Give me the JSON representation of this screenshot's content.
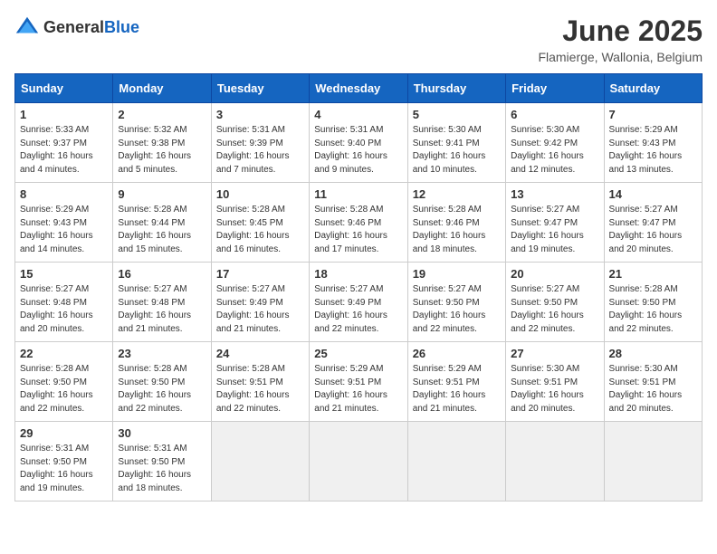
{
  "logo": {
    "general": "General",
    "blue": "Blue"
  },
  "title": "June 2025",
  "location": "Flamierge, Wallonia, Belgium",
  "days_of_week": [
    "Sunday",
    "Monday",
    "Tuesday",
    "Wednesday",
    "Thursday",
    "Friday",
    "Saturday"
  ],
  "weeks": [
    [
      {
        "day": "1",
        "sunrise": "5:33 AM",
        "sunset": "9:37 PM",
        "daylight": "16 hours and 4 minutes."
      },
      {
        "day": "2",
        "sunrise": "5:32 AM",
        "sunset": "9:38 PM",
        "daylight": "16 hours and 5 minutes."
      },
      {
        "day": "3",
        "sunrise": "5:31 AM",
        "sunset": "9:39 PM",
        "daylight": "16 hours and 7 minutes."
      },
      {
        "day": "4",
        "sunrise": "5:31 AM",
        "sunset": "9:40 PM",
        "daylight": "16 hours and 9 minutes."
      },
      {
        "day": "5",
        "sunrise": "5:30 AM",
        "sunset": "9:41 PM",
        "daylight": "16 hours and 10 minutes."
      },
      {
        "day": "6",
        "sunrise": "5:30 AM",
        "sunset": "9:42 PM",
        "daylight": "16 hours and 12 minutes."
      },
      {
        "day": "7",
        "sunrise": "5:29 AM",
        "sunset": "9:43 PM",
        "daylight": "16 hours and 13 minutes."
      }
    ],
    [
      {
        "day": "8",
        "sunrise": "5:29 AM",
        "sunset": "9:43 PM",
        "daylight": "16 hours and 14 minutes."
      },
      {
        "day": "9",
        "sunrise": "5:28 AM",
        "sunset": "9:44 PM",
        "daylight": "16 hours and 15 minutes."
      },
      {
        "day": "10",
        "sunrise": "5:28 AM",
        "sunset": "9:45 PM",
        "daylight": "16 hours and 16 minutes."
      },
      {
        "day": "11",
        "sunrise": "5:28 AM",
        "sunset": "9:46 PM",
        "daylight": "16 hours and 17 minutes."
      },
      {
        "day": "12",
        "sunrise": "5:28 AM",
        "sunset": "9:46 PM",
        "daylight": "16 hours and 18 minutes."
      },
      {
        "day": "13",
        "sunrise": "5:27 AM",
        "sunset": "9:47 PM",
        "daylight": "16 hours and 19 minutes."
      },
      {
        "day": "14",
        "sunrise": "5:27 AM",
        "sunset": "9:47 PM",
        "daylight": "16 hours and 20 minutes."
      }
    ],
    [
      {
        "day": "15",
        "sunrise": "5:27 AM",
        "sunset": "9:48 PM",
        "daylight": "16 hours and 20 minutes."
      },
      {
        "day": "16",
        "sunrise": "5:27 AM",
        "sunset": "9:48 PM",
        "daylight": "16 hours and 21 minutes."
      },
      {
        "day": "17",
        "sunrise": "5:27 AM",
        "sunset": "9:49 PM",
        "daylight": "16 hours and 21 minutes."
      },
      {
        "day": "18",
        "sunrise": "5:27 AM",
        "sunset": "9:49 PM",
        "daylight": "16 hours and 22 minutes."
      },
      {
        "day": "19",
        "sunrise": "5:27 AM",
        "sunset": "9:50 PM",
        "daylight": "16 hours and 22 minutes."
      },
      {
        "day": "20",
        "sunrise": "5:27 AM",
        "sunset": "9:50 PM",
        "daylight": "16 hours and 22 minutes."
      },
      {
        "day": "21",
        "sunrise": "5:28 AM",
        "sunset": "9:50 PM",
        "daylight": "16 hours and 22 minutes."
      }
    ],
    [
      {
        "day": "22",
        "sunrise": "5:28 AM",
        "sunset": "9:50 PM",
        "daylight": "16 hours and 22 minutes."
      },
      {
        "day": "23",
        "sunrise": "5:28 AM",
        "sunset": "9:50 PM",
        "daylight": "16 hours and 22 minutes."
      },
      {
        "day": "24",
        "sunrise": "5:28 AM",
        "sunset": "9:51 PM",
        "daylight": "16 hours and 22 minutes."
      },
      {
        "day": "25",
        "sunrise": "5:29 AM",
        "sunset": "9:51 PM",
        "daylight": "16 hours and 21 minutes."
      },
      {
        "day": "26",
        "sunrise": "5:29 AM",
        "sunset": "9:51 PM",
        "daylight": "16 hours and 21 minutes."
      },
      {
        "day": "27",
        "sunrise": "5:30 AM",
        "sunset": "9:51 PM",
        "daylight": "16 hours and 20 minutes."
      },
      {
        "day": "28",
        "sunrise": "5:30 AM",
        "sunset": "9:51 PM",
        "daylight": "16 hours and 20 minutes."
      }
    ],
    [
      {
        "day": "29",
        "sunrise": "5:31 AM",
        "sunset": "9:50 PM",
        "daylight": "16 hours and 19 minutes."
      },
      {
        "day": "30",
        "sunrise": "5:31 AM",
        "sunset": "9:50 PM",
        "daylight": "16 hours and 18 minutes."
      },
      null,
      null,
      null,
      null,
      null
    ]
  ],
  "labels": {
    "sunrise": "Sunrise:",
    "sunset": "Sunset:",
    "daylight": "Daylight:"
  }
}
